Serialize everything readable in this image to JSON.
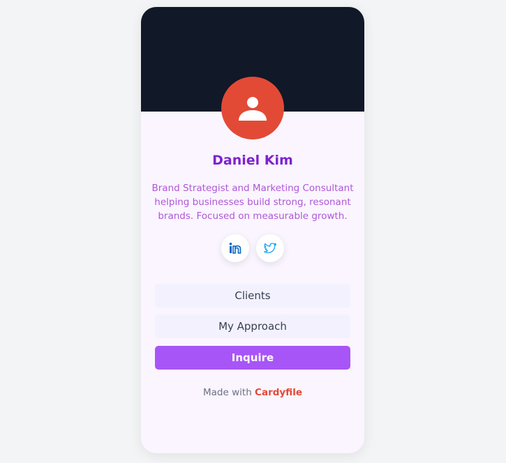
{
  "profile": {
    "name": "Daniel Kim",
    "bio": "Brand Strategist and Marketing Consultant helping businesses build strong, resonant brands. Focused on measurable growth."
  },
  "social": [
    {
      "icon": "linkedin-icon",
      "color": "#0a66c2"
    },
    {
      "icon": "twitter-icon",
      "color": "#1da1f2"
    }
  ],
  "links": {
    "clients": "Clients",
    "approach": "My Approach",
    "inquire": "Inquire"
  },
  "footer": {
    "prefix": "Made with",
    "brand": "Cardyfile"
  },
  "colors": {
    "banner": "#111827",
    "avatar": "#e24a36",
    "accent": "#a855f7",
    "name": "#7e22ce",
    "brand": "#e24a36"
  }
}
